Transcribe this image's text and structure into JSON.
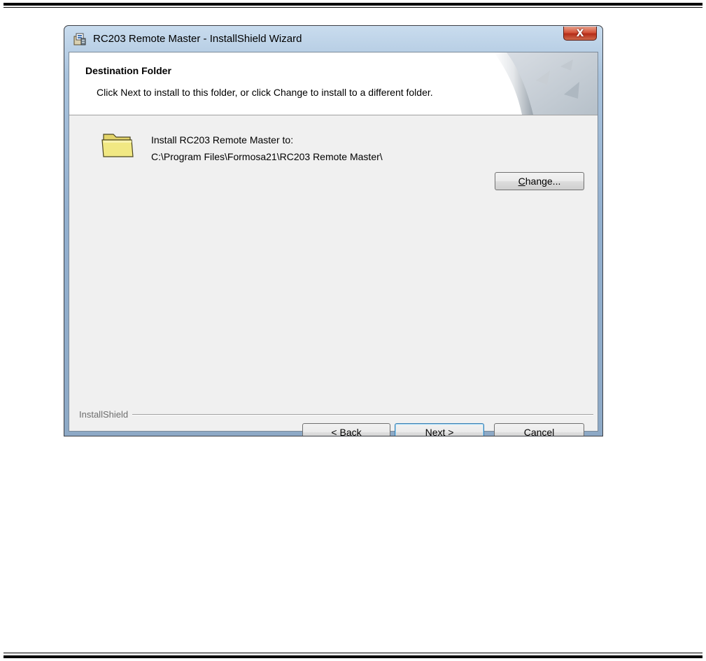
{
  "window": {
    "title": "RC203 Remote Master - InstallShield Wizard",
    "close_glyph": "X"
  },
  "header": {
    "title": "Destination Folder",
    "description": "Click Next to install to this folder, or click Change to install to a different folder."
  },
  "content": {
    "install_label": "Install RC203 Remote Master to:",
    "install_path": "C:\\Program Files\\Formosa21\\RC203 Remote Master\\",
    "folder_icon": "folder-icon"
  },
  "buttons": {
    "change": {
      "mnemonic": "C",
      "rest": "hange..."
    },
    "back": {
      "prefix": "< ",
      "mnemonic": "B",
      "rest": "ack"
    },
    "next": {
      "mnemonic": "N",
      "rest": "ext >"
    },
    "cancel": "Cancel"
  },
  "footer": {
    "brand": "InstallShield"
  },
  "colors": {
    "client_bg": "#f0f0f0",
    "close_red": "#c74a32",
    "frame_blue": "#93b0cf"
  }
}
